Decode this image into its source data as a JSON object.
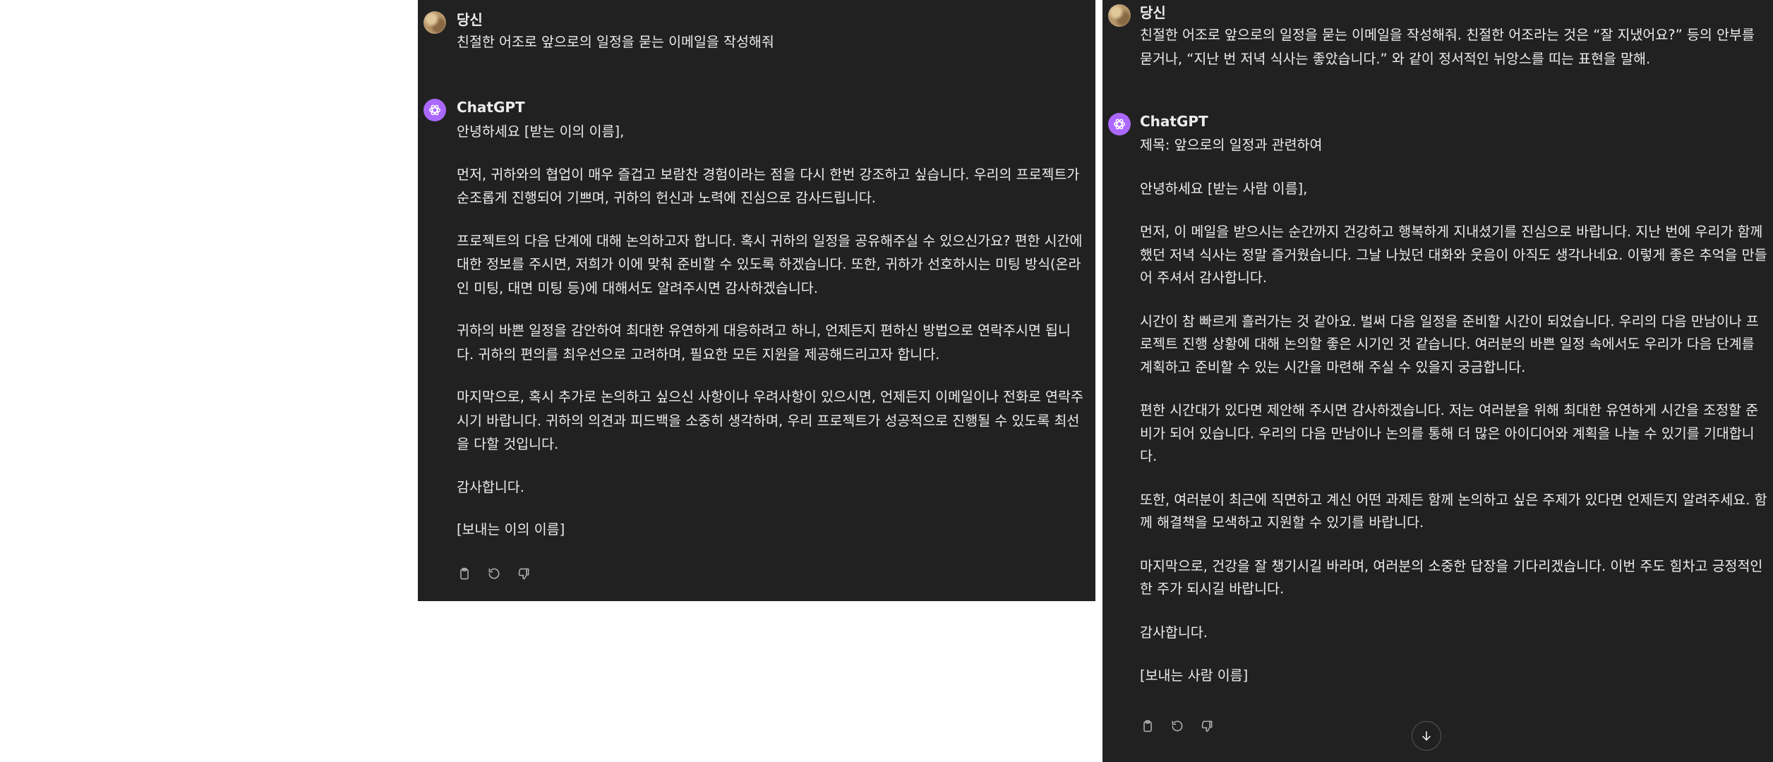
{
  "left": {
    "user": {
      "name": "당신",
      "message": "친절한 어조로 앞으로의 일정을 묻는 이메일을 작성해줘"
    },
    "assistant": {
      "name": "ChatGPT",
      "paragraphs": [
        "안녕하세요 [받는 이의 이름],",
        "먼저, 귀하와의 협업이 매우 즐겁고 보람찬 경험이라는 점을 다시 한번 강조하고 싶습니다. 우리의 프로젝트가 순조롭게 진행되어 기쁘며, 귀하의 헌신과 노력에 진심으로 감사드립니다.",
        "프로젝트의 다음 단계에 대해 논의하고자 합니다. 혹시 귀하의 일정을 공유해주실 수 있으신가요? 편한 시간에 대한 정보를 주시면, 저희가 이에 맞춰 준비할 수 있도록 하겠습니다. 또한, 귀하가 선호하시는 미팅 방식(온라인 미팅, 대면 미팅 등)에 대해서도 알려주시면 감사하겠습니다.",
        "귀하의 바쁜 일정을 감안하여 최대한 유연하게 대응하려고 하니, 언제든지 편하신 방법으로 연락주시면 됩니다. 귀하의 편의를 최우선으로 고려하며, 필요한 모든 지원을 제공해드리고자 합니다.",
        "마지막으로, 혹시 추가로 논의하고 싶으신 사항이나 우려사항이 있으시면, 언제든지 이메일이나 전화로 연락주시기 바랍니다. 귀하의 의견과 피드백을 소중히 생각하며, 우리 프로젝트가 성공적으로 진행될 수 있도록 최선을 다할 것입니다.",
        "감사합니다.",
        "[보내는 이의 이름]"
      ]
    }
  },
  "right": {
    "user": {
      "name": "당신",
      "message": "친절한 어조로 앞으로의 일정을 묻는 이메일을 작성해줘. 친절한 어조라는 것은 “잘 지냈어요?” 등의 안부를 묻거나, “지난 번 저녁 식사는 좋았습니다.” 와 같이 정서적인 뉘앙스를 띠는 표현을 말해."
    },
    "assistant": {
      "name": "ChatGPT",
      "subject": "제목: 앞으로의 일정과 관련하여",
      "paragraphs": [
        "안녕하세요 [받는 사람 이름],",
        "먼저, 이 메일을 받으시는 순간까지 건강하고 행복하게 지내셨기를 진심으로 바랍니다. 지난 번에 우리가 함께 했던 저녁 식사는 정말 즐거웠습니다. 그날 나눴던 대화와 웃음이 아직도 생각나네요. 이렇게 좋은 추억을 만들어 주셔서 감사합니다.",
        "시간이 참 빠르게 흘러가는 것 같아요. 벌써 다음 일정을 준비할 시간이 되었습니다. 우리의 다음 만남이나 프로젝트 진행 상황에 대해 논의할 좋은 시기인 것 같습니다. 여러분의 바쁜 일정 속에서도 우리가 다음 단계를 계획하고 준비할 수 있는 시간을 마련해 주실 수 있을지 궁금합니다.",
        "편한 시간대가 있다면 제안해 주시면 감사하겠습니다. 저는 여러분을 위해 최대한 유연하게 시간을 조정할 준비가 되어 있습니다. 우리의 다음 만남이나 논의를 통해 더 많은 아이디어와 계획을 나눌 수 있기를 기대합니다.",
        "또한, 여러분이 최근에 직면하고 계신 어떤 과제든 함께 논의하고 싶은 주제가 있다면 언제든지 알려주세요. 함께 해결책을 모색하고 지원할 수 있기를 바랍니다.",
        "마지막으로, 건강을 잘 챙기시길 바라며, 여러분의 소중한 답장을 기다리겠습니다. 이번 주도 힘차고 긍정적인 한 주가 되시길 바랍니다.",
        "감사합니다.",
        "[보내는 사람 이름]"
      ]
    }
  },
  "icons": {
    "copy": "clipboard-icon",
    "regenerate": "refresh-icon",
    "dislike": "thumbs-down-icon",
    "scroll": "arrow-down-icon"
  },
  "colors": {
    "background": "#212121",
    "text": "#ececec",
    "gpt_avatar": "#ab68ff",
    "icon": "#b4b4b4"
  }
}
